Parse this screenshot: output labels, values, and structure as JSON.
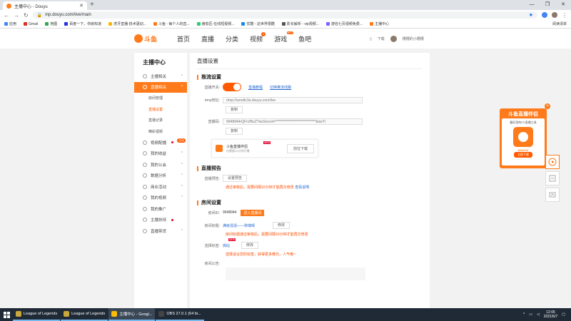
{
  "browser": {
    "tab_title": "主播中心 - Douyu",
    "url": "mp.douyu.com/live/main",
    "new_tab": "+",
    "window_controls": [
      "—",
      "❐",
      "✕"
    ],
    "bookmarks": [
      {
        "label": "应用",
        "color": "#4285f4"
      },
      {
        "label": "Gmail",
        "color": "#d93025"
      },
      {
        "label": "地图",
        "color": "#34a853"
      },
      {
        "label": "百度一下，你就知道",
        "color": "#2932e1"
      },
      {
        "label": "虎牙直播-技术驱动...",
        "color": "#ffb400"
      },
      {
        "label": "斗鱼 - 每个人的直...",
        "color": "#ff7a1a"
      },
      {
        "label": "番茄区-在线短视频...",
        "color": "#2ecc71"
      },
      {
        "label": "优酷 - 这世界很酷",
        "color": "#1e88e5"
      },
      {
        "label": "影长解析 - vip视频...",
        "color": "#555555"
      },
      {
        "label": "游信七页视频免费...",
        "color": "#7b61ff"
      },
      {
        "label": "主播中心",
        "color": "#ff7a1a"
      }
    ],
    "reading_list": "阅读清单"
  },
  "header": {
    "logo_text": "斗鱼",
    "nav": [
      "首页",
      "直播",
      "分类",
      "视频",
      "游戏",
      "鱼吧"
    ],
    "nav_badge_video": "1",
    "nav_badge_game": "HOT",
    "download": "下载",
    "username": "槽槽的小槽槽"
  },
  "sidebar": {
    "title": "主播中心",
    "items": [
      {
        "label": "主播相关",
        "caret": "^"
      },
      {
        "label": "直播相关",
        "caret": "^"
      }
    ],
    "subs": [
      "房间管理",
      "直播设置",
      "直播记录",
      "精彩视频"
    ],
    "items2": [
      {
        "label": "视频配播",
        "caret": "",
        "badge": "活动"
      },
      {
        "label": "我的收益",
        "caret": "^"
      },
      {
        "label": "我的公会",
        "caret": "^"
      },
      {
        "label": "数据分析",
        "caret": "^"
      },
      {
        "label": "商业活动",
        "caret": "^"
      },
      {
        "label": "我的视频",
        "caret": "^"
      },
      {
        "label": "我的推广",
        "caret": ""
      },
      {
        "label": "主播扶持",
        "caret": ""
      },
      {
        "label": "直播带货",
        "caret": "^"
      }
    ]
  },
  "main": {
    "title": "直播设置",
    "section_stream": "推流设置",
    "toggle_label": "直播开关:",
    "link_tutorial": "直播教程",
    "link_switch": "切换推流线路",
    "rtmp_label": "rtmp地址:",
    "rtmp_value": "rtmp://sendtc3a.douyu.com/live",
    "copy": "复制",
    "code_label": "直播码:",
    "code_value": "9948944rQFrcfNvZ?wsSecret=*****************************&wsTi",
    "promo_title": "斗鱼直播伴侣",
    "promo_sub": "仅需摄10分钟开播",
    "promo_new": "NEW",
    "promo_download": "前往下载",
    "section_preview": "直播预告",
    "preview_label": "直播预告:",
    "preview_btn": "设置预告",
    "preview_warn": "通过审核后，需要间隔10分钟才能再次修改",
    "preview_link": "查看说明",
    "section_room": "房间设置",
    "room_id_label": "房间ID:",
    "room_id": "9948944",
    "room_id_btn": "进入直播间",
    "room_title_label": "房间标题:",
    "room_title": "满级混混——称端晴",
    "modify": "修改",
    "room_title_warn": "房间标题通过审核后，需要间隔10分钟才能再次修改",
    "tag_label": "选择标签:",
    "tag_new": "NEW",
    "tag_value": "搞砧",
    "tag_warn": "选择适合您的标签，获得更多曝光，人气哦~",
    "notice_label": "房间公告:"
  },
  "float_widget": {
    "title": "斗鱼直播伴侣",
    "text": "最好用的PC直播工具",
    "app": "DOUYU",
    "btn": "立即下载",
    "close": "×"
  },
  "taskbar": {
    "apps": [
      {
        "label": "League of Legends",
        "color": "#c9a83a"
      },
      {
        "label": "League of Legends",
        "color": "#c9a83a"
      },
      {
        "label": "主播中心 - Googl...",
        "color": "#fbbc05"
      },
      {
        "label": "OBS 27.0.1 (64 bi...",
        "color": "#444444"
      }
    ],
    "time": "12:05",
    "date": "2021/6/7"
  }
}
